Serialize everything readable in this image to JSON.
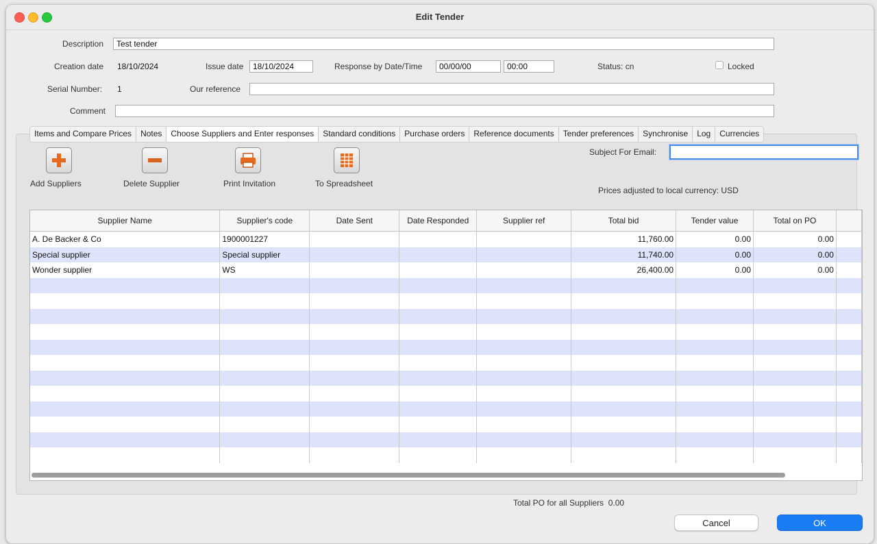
{
  "window": {
    "title": "Edit Tender"
  },
  "form": {
    "description_label": "Description",
    "description_value": "Test tender",
    "creation_date_label": "Creation date",
    "creation_date_value": "18/10/2024",
    "issue_date_label": "Issue date",
    "issue_date_value": "18/10/2024",
    "response_label": "Response by Date/Time",
    "response_date_value": "00/00/00",
    "response_time_value": "00:00",
    "status_label": "Status:",
    "status_value": "cn",
    "locked_label": "Locked",
    "serial_label": "Serial Number:",
    "serial_value": "1",
    "our_reference_label": "Our reference",
    "our_reference_value": "",
    "comment_label": "Comment",
    "comment_value": ""
  },
  "tabs": [
    {
      "label": "Items and Compare Prices"
    },
    {
      "label": "Notes"
    },
    {
      "label": "Choose Suppliers and Enter responses"
    },
    {
      "label": "Standard conditions"
    },
    {
      "label": "Purchase orders"
    },
    {
      "label": "Reference documents"
    },
    {
      "label": "Tender preferences"
    },
    {
      "label": "Synchronise"
    },
    {
      "label": "Log"
    },
    {
      "label": "Currencies"
    }
  ],
  "active_tab": "Choose Suppliers and Enter responses",
  "toolbar": {
    "add_suppliers": "Add Suppliers",
    "delete_supplier": "Delete Supplier",
    "print_invitation": "Print Invitation",
    "to_spreadsheet": "To Spreadsheet"
  },
  "email": {
    "label": "Subject For Email:",
    "value": ""
  },
  "currency_note": "Prices adjusted to local currency: USD",
  "table": {
    "columns": [
      "Supplier Name",
      "Supplier's code",
      "Date Sent",
      "Date Responded",
      "Supplier ref",
      "Total bid",
      "Tender value",
      "Total on PO"
    ],
    "rows": [
      [
        "A. De Backer & Co",
        "1900001227",
        "",
        "",
        "",
        "11,760.00",
        "0.00",
        "0.00"
      ],
      [
        "Special supplier",
        "Special supplier",
        "",
        "",
        "",
        "11,740.00",
        "0.00",
        "0.00"
      ],
      [
        "Wonder supplier",
        "WS",
        "",
        "",
        "",
        "26,400.00",
        "0.00",
        "0.00"
      ]
    ]
  },
  "footer": {
    "total_po_label": "Total PO for all Suppliers",
    "total_po_value": "0.00",
    "cancel": "Cancel",
    "ok": "OK"
  },
  "colors": {
    "accent": "#1a7cf5",
    "row_alt": "#dde3fa",
    "add_icon": "#e8691e"
  }
}
